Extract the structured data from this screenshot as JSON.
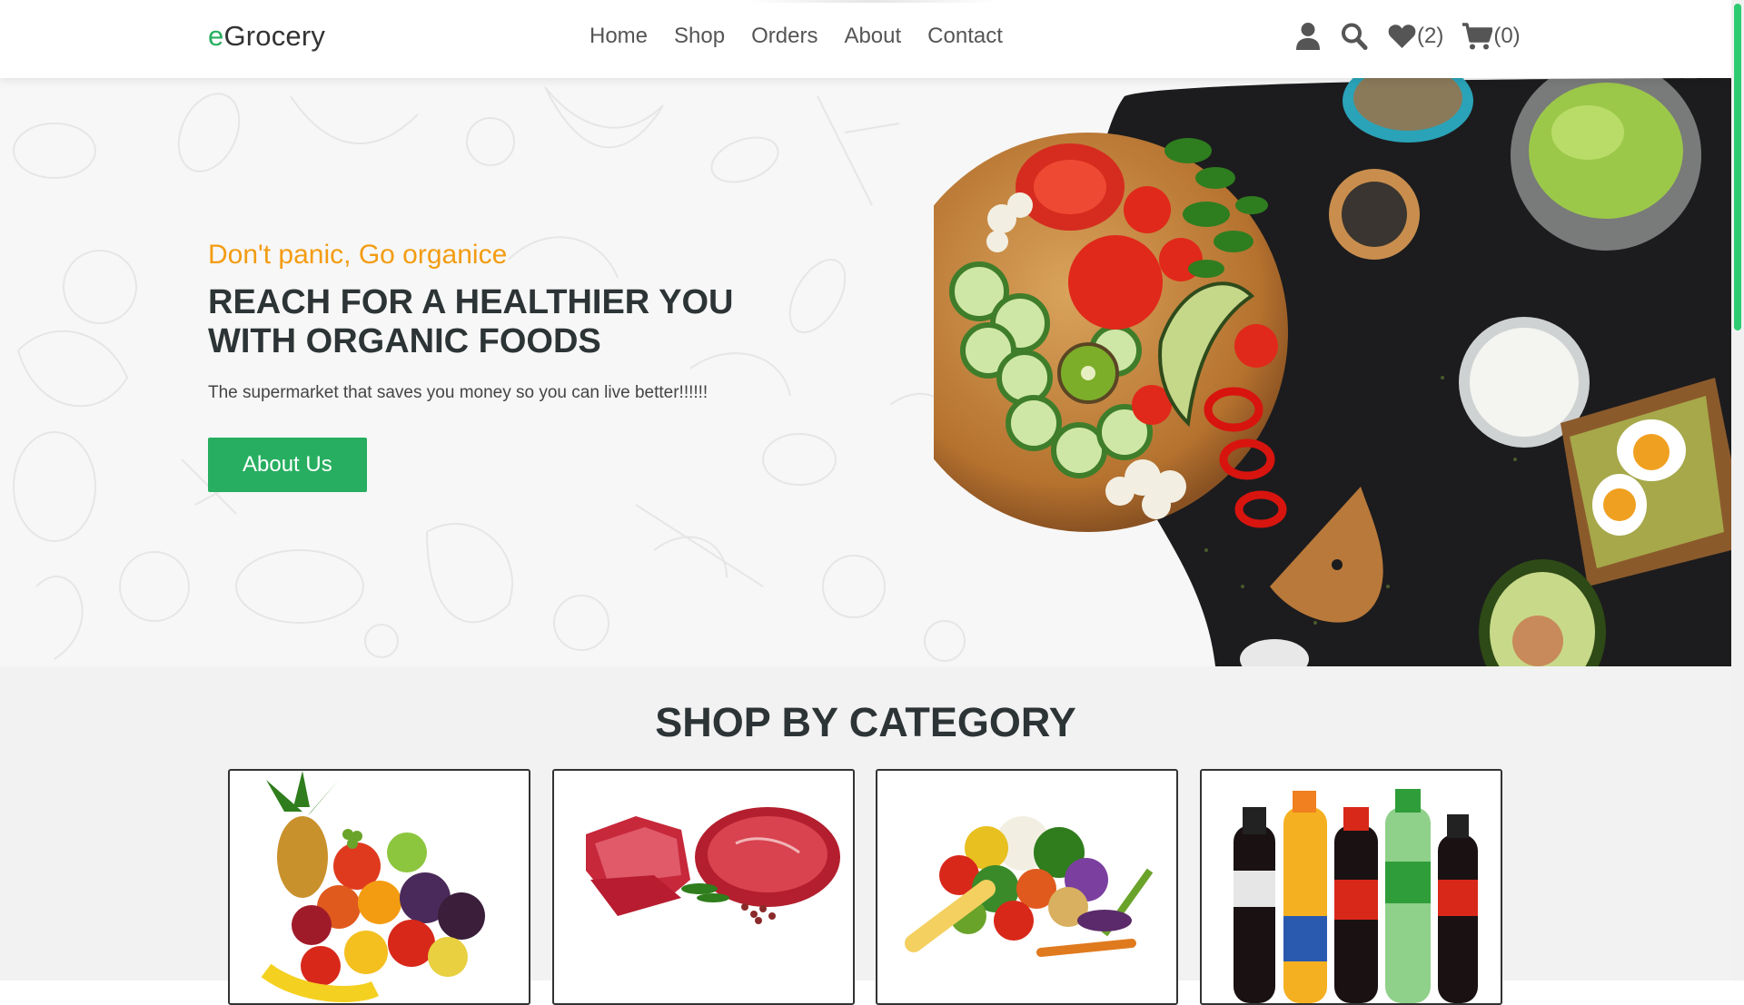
{
  "header": {
    "logo_prefix": "e",
    "logo_rest": "Grocery",
    "nav": [
      {
        "label": "Home"
      },
      {
        "label": "Shop"
      },
      {
        "label": "Orders"
      },
      {
        "label": "About"
      },
      {
        "label": "Contact"
      }
    ],
    "icons": {
      "user": "user-icon",
      "search": "search-icon",
      "wishlist": "heart-icon",
      "wishlist_count": "(2)",
      "cart": "cart-icon",
      "cart_count": "(0)"
    }
  },
  "hero": {
    "tagline": "Don't panic, Go organice",
    "headline_line1": "REACH FOR A HEALTHIER YOU",
    "headline_line2": "WITH ORGANIC FOODS",
    "subtext": "The supermarket that saves you money so you can live better!!!!!!",
    "button_label": "About Us"
  },
  "category": {
    "title": "SHOP BY CATEGORY",
    "cards": [
      {
        "name": "fruits"
      },
      {
        "name": "meat"
      },
      {
        "name": "vegetables"
      },
      {
        "name": "drinks"
      }
    ]
  },
  "colors": {
    "accent_green": "#27ae60",
    "tagline_orange": "#f39c12",
    "heading_dark": "#2d3436"
  }
}
